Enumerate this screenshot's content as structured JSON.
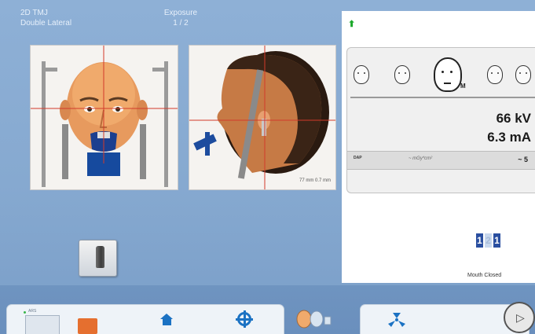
{
  "header": {
    "program_name": "2D TMJ",
    "program_mode": "Double Lateral",
    "phase_label": "Exposure",
    "phase_counter": "1  /  2"
  },
  "preview": {
    "side_caption": "77 mm 0.7 mm"
  },
  "settings": {
    "arrow_icon": "up-arrow",
    "patient_sizes": [
      "XS",
      "S",
      "M",
      "L",
      "XL"
    ],
    "selected_size": "M",
    "kv": "66 kV",
    "ma": "6.3 mA",
    "dose_label": "DAP",
    "dose_unit": "~ mGy*cm²",
    "dose_value": "~ 5",
    "mouth_digits": [
      "1",
      "2",
      "1"
    ],
    "mouth_label": "Mouth Closed"
  },
  "sensor_button": {
    "label": "sensor-holder"
  },
  "toolbar": {
    "mini_label": "ARS",
    "icons": [
      "home-icon",
      "positioning-target-icon",
      "patient-icon",
      "radiation-icon",
      "play-icon"
    ],
    "play_glyph": "▷"
  },
  "colors": {
    "background": "#86a9d0",
    "accent_blue": "#1b72c3",
    "orange": "#e56f2f",
    "green": "#1aa82a"
  }
}
